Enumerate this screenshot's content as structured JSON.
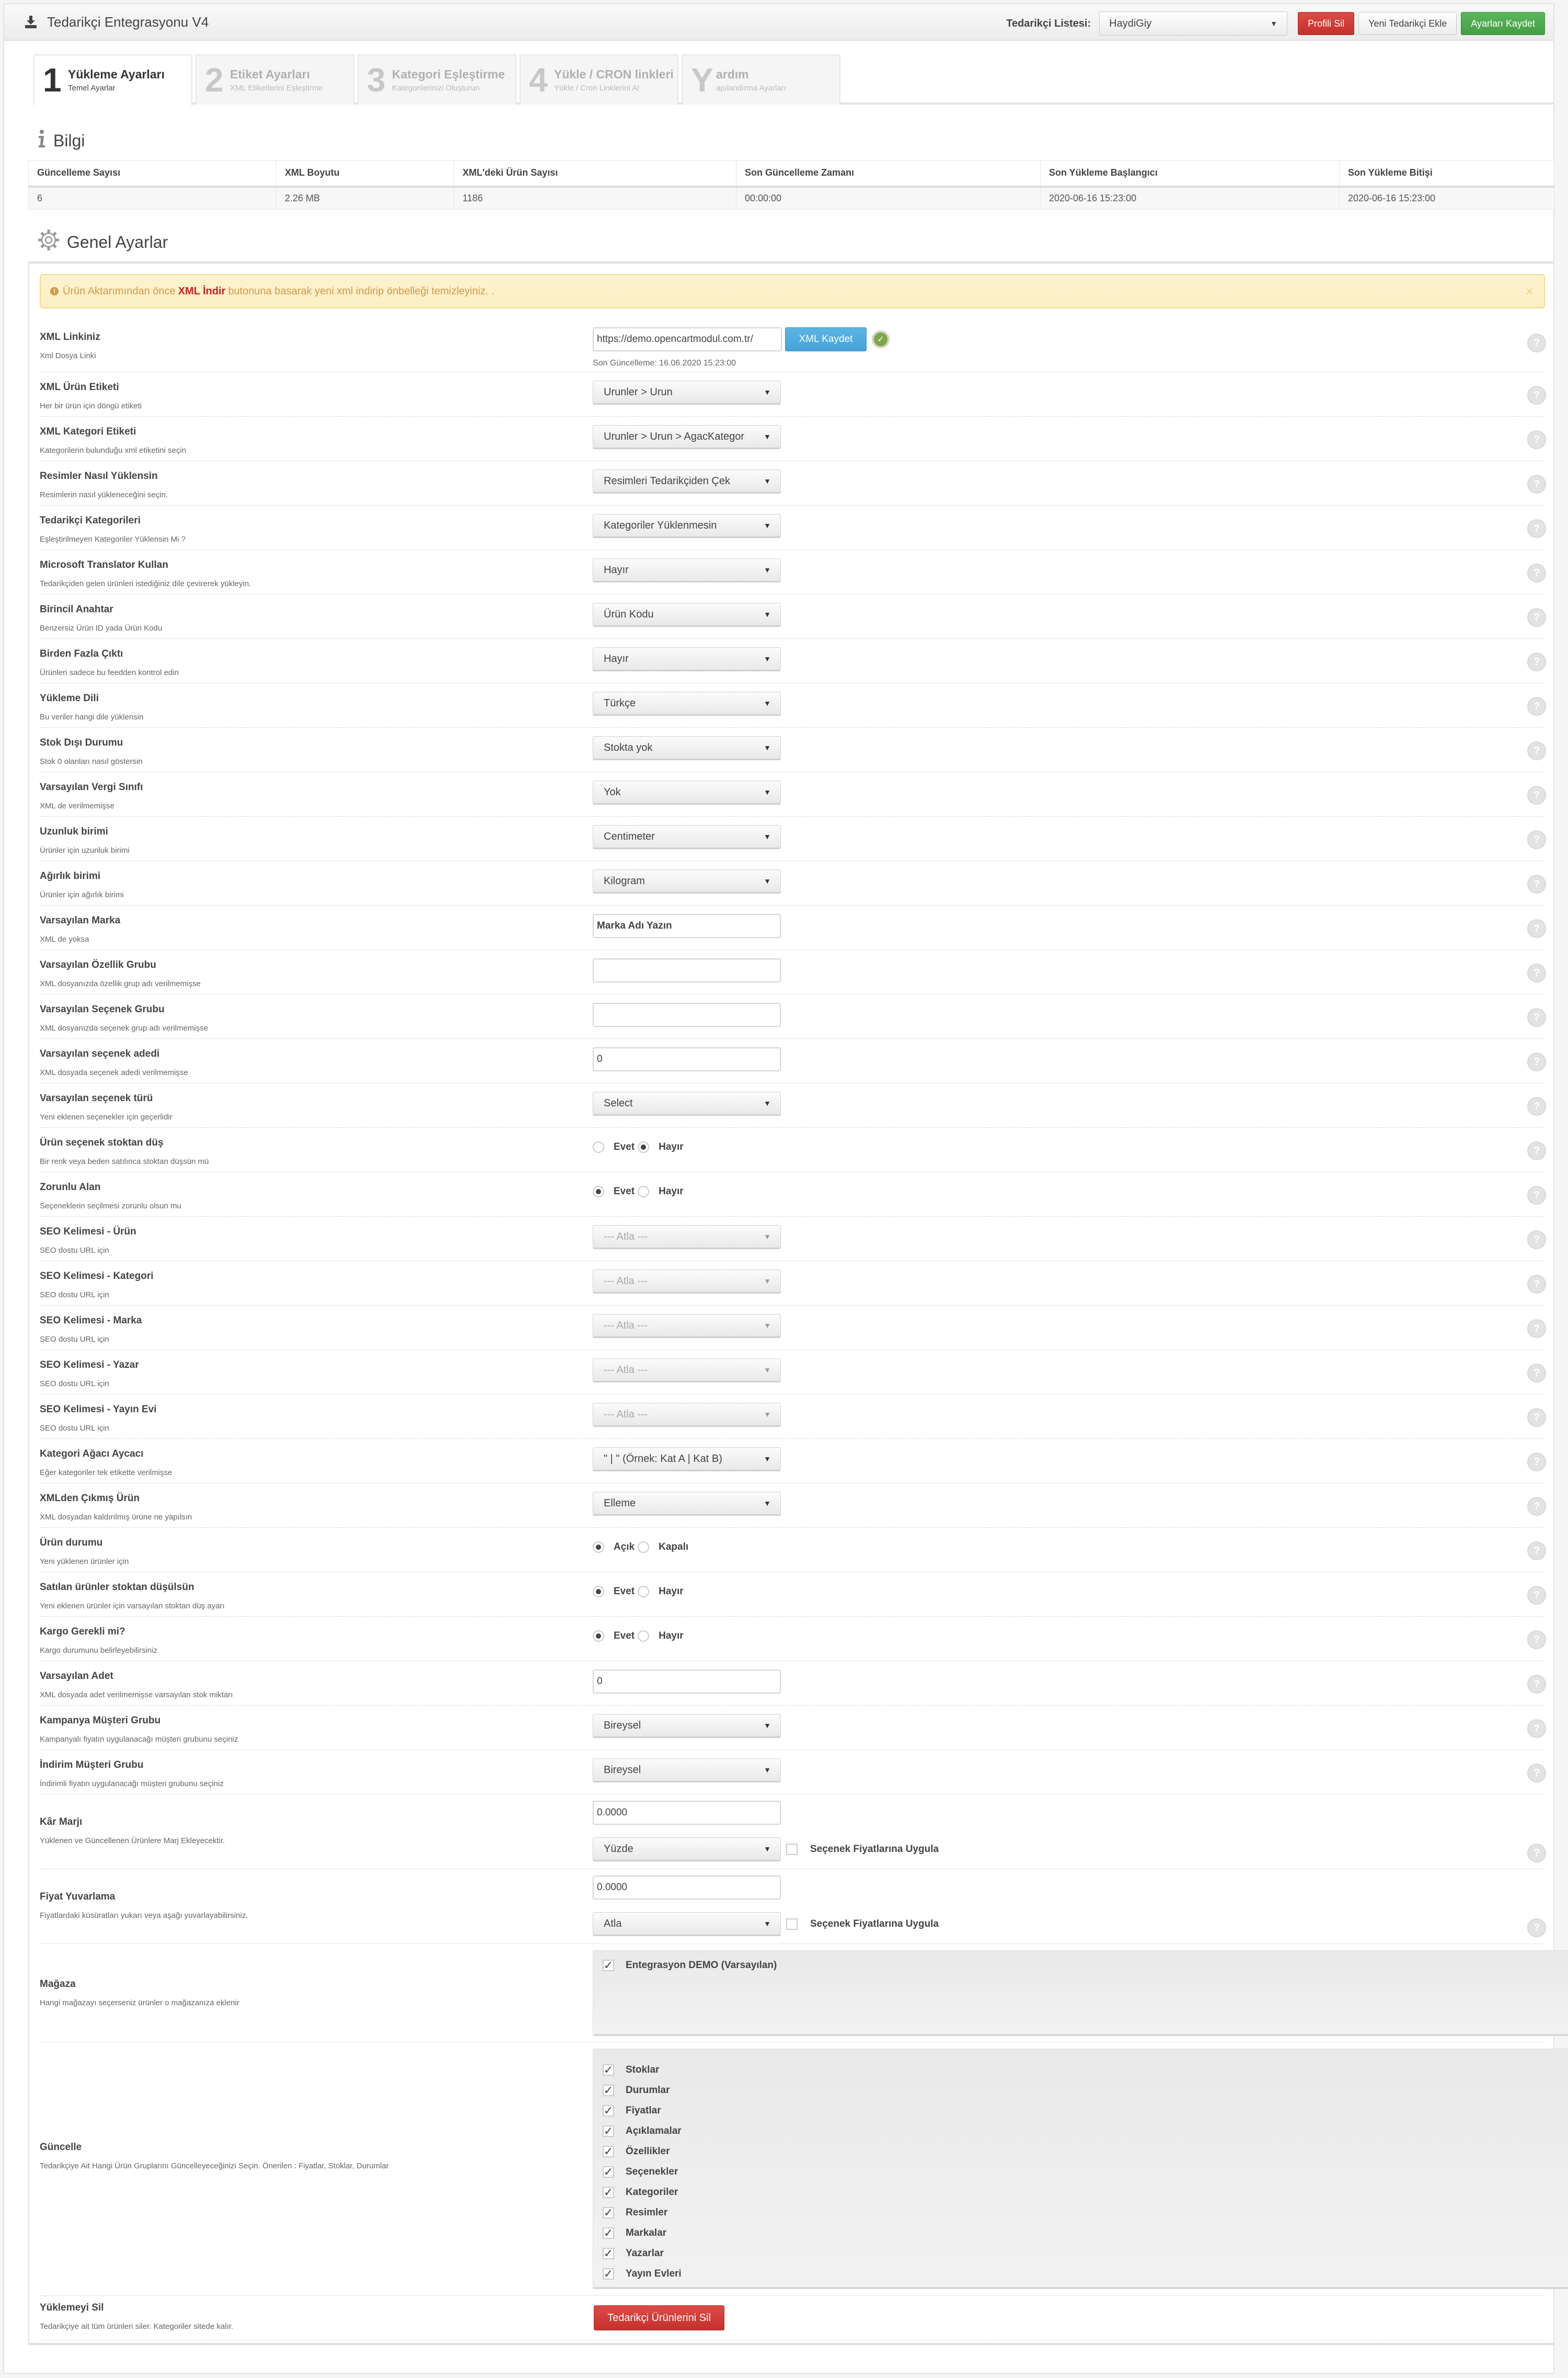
{
  "header": {
    "title": "Tedarikçi Entegrasyonu V4",
    "title_icon": "download-icon",
    "supplier_label": "Tedarikçi Listesi:",
    "supplier_selected": "HaydiGiy",
    "delete_profile": "Profili Sil",
    "add_supplier": "Yeni Tedarikçi Ekle",
    "save_settings": "Ayarları Kaydet"
  },
  "tabs": [
    {
      "num": "1",
      "title": "Yükleme Ayarları",
      "subtitle": "Temel Ayarlar",
      "active": true
    },
    {
      "num": "2",
      "title": "Etiket Ayarları",
      "subtitle": "XML Etiketlerini Eşleştirme",
      "active": false
    },
    {
      "num": "3",
      "title": "Kategori Eşleştirme",
      "subtitle": "Kategorilerinizi Oluşturun",
      "active": false
    },
    {
      "num": "4",
      "title": "Yükle / CRON linkleri",
      "subtitle": "Yükle / Cron Linklerini Al",
      "active": false
    },
    {
      "num": "Y",
      "title": "ardım",
      "subtitle": "apılandırma Ayarları",
      "active": false
    }
  ],
  "info": {
    "title": "Bilgi",
    "icon": "info-icon",
    "columns": [
      "Güncelleme Sayısı",
      "XML Boyutu",
      "XML'deki Ürün Sayısı",
      "Son Güncelleme Zamanı",
      "Son Yükleme Başlangıcı",
      "Son Yükleme Bitişi"
    ],
    "row": [
      "6",
      "2.26 MB",
      "1186",
      "00:00:00",
      "2020-06-16 15:23:00",
      "2020-06-16 15:23:00"
    ]
  },
  "general": {
    "title": "Genel Ayarlar",
    "icon": "gear-icon",
    "alert": {
      "before": "Ürün Aktarımından önce",
      "highlight": "XML İndir",
      "after": "butonuna basarak yeni xml indirip önbelleği temizleyiniz. .",
      "close": "×"
    },
    "xml_link": {
      "label": "XML Linkiniz",
      "hint": "Xml Dosya Linki",
      "value": "https://demo.opencartmodul.com.tr/",
      "button": "XML Kaydet",
      "last_update": "Son Güncelleme: 16.06.2020 15:23:00"
    },
    "rows": [
      {
        "label": "XML Ürün Etiketi",
        "hint": "Her bir ürün için döngü etiketi",
        "type": "select",
        "value": "Urunler > Urun"
      },
      {
        "label": "XML Kategori Etiketi",
        "hint": "Kategorilerin bulunduğu xml etiketini seçin",
        "type": "select",
        "value": "Urunler > Urun > AgacKategor"
      },
      {
        "label": "Resimler Nasıl Yüklensin",
        "hint": "Resimlerin nasıl yükleneceğini seçin.",
        "type": "select",
        "value": "Resimleri Tedarikçiden Çek"
      },
      {
        "label": "Tedarikçi Kategorileri",
        "hint": "Eşleştirilmeyen Kategoriler Yüklensin Mi ?",
        "type": "select",
        "value": "Kategoriler Yüklenmesin"
      },
      {
        "label": "Microsoft Translator Kullan",
        "hint": "Tedarikçiden gelen ürünleri istediğiniz dile çevirerek yükleyin.",
        "type": "select",
        "value": "Hayır"
      },
      {
        "label": "Birincil Anahtar",
        "hint": "Benzersiz Ürün ID yada Ürün Kodu",
        "type": "select",
        "value": "Ürün Kodu"
      },
      {
        "label": "Birden Fazla Çıktı",
        "hint": "Ürünleri sadece bu feedden kontrol edin",
        "type": "select",
        "value": "Hayır"
      },
      {
        "label": "Yükleme Dili",
        "hint": "Bu veriler hangi dile yüklensin",
        "type": "select",
        "value": "Türkçe"
      },
      {
        "label": "Stok Dışı Durumu",
        "hint": "Stok 0 olanları nasıl göstersin",
        "type": "select",
        "value": "Stokta yok"
      },
      {
        "label": "Varsayılan Vergi Sınıfı",
        "hint": "XML de verilmemişse",
        "type": "select",
        "value": "Yok"
      },
      {
        "label": "Uzunluk birimi",
        "hint": "Ürünler için uzunluk birimi",
        "type": "select",
        "value": "Centimeter"
      },
      {
        "label": "Ağırlık birimi",
        "hint": "Ürünler için ağırlık birimi",
        "type": "select",
        "value": "Kilogram"
      },
      {
        "label": "Varsayılan Marka",
        "hint": "XML de yoksa",
        "type": "input",
        "value": "Marka Adı Yazın",
        "bold": true
      },
      {
        "label": "Varsayılan Özellik Grubu",
        "hint": "XML dosyanızda özellik grup adı verilmemişse",
        "type": "input",
        "value": ""
      },
      {
        "label": "Varsayılan Seçenek Grubu",
        "hint": "XML dosyanızda seçenek grup adı verilmemişse",
        "type": "input",
        "value": ""
      },
      {
        "label": "Varsayılan seçenek adedi",
        "hint": "XML dosyada seçenek adedi verilmemişse",
        "type": "input",
        "value": "0"
      },
      {
        "label": "Varsayılan seçenek türü",
        "hint": "Yeni eklenen seçenekler için geçerlidir",
        "type": "select",
        "value": "Select"
      },
      {
        "label": "Ürün seçenek stoktan düş",
        "hint": "Bir renk veya beden satılınca stoktan düşsün mü",
        "type": "radio",
        "options": [
          "Evet",
          "Hayır"
        ],
        "selected": 1
      },
      {
        "label": "Zorunlu Alan",
        "hint": "Seçeneklerin seçilmesi zorunlu olsun mu",
        "type": "radio",
        "options": [
          "Evet",
          "Hayır"
        ],
        "selected": 0
      },
      {
        "label": "SEO Kelimesi - Ürün",
        "hint": "SEO dostu URL için",
        "type": "select",
        "value": "--- Atla ---",
        "disabled": true
      },
      {
        "label": "SEO Kelimesi - Kategori",
        "hint": "SEO dostu URL için",
        "type": "select",
        "value": "--- Atla ---",
        "disabled": true
      },
      {
        "label": "SEO Kelimesi - Marka",
        "hint": "SEO dostu URL için",
        "type": "select",
        "value": "--- Atla ---",
        "disabled": true
      },
      {
        "label": "SEO Kelimesi - Yazar",
        "hint": "SEO dostu URL için",
        "type": "select",
        "value": "--- Atla ---",
        "disabled": true
      },
      {
        "label": "SEO Kelimesi - Yayın Evi",
        "hint": "SEO dostu URL için",
        "type": "select",
        "value": "--- Atla ---",
        "disabled": true
      },
      {
        "label": "Kategori Ağacı Aycacı",
        "hint": "Eğer kategoriler tek etikette verilmişse",
        "type": "select",
        "value": "\" | \" (Örnek: Kat A | Kat B)"
      },
      {
        "label": "XMLden Çıkmış Ürün",
        "hint": "XML dosyadan kaldırılmış ürüne ne yapılsın",
        "type": "select",
        "value": "Elleme"
      },
      {
        "label": "Ürün durumu",
        "hint": "Yeni yüklenen ürünler için",
        "type": "radio",
        "options": [
          "Açık",
          "Kapalı"
        ],
        "selected": 0
      },
      {
        "label": "Satılan ürünler stoktan düşülsün",
        "hint": "Yeni eklenen ürünler için varsayılan stoktan düş ayarı",
        "type": "radio",
        "options": [
          "Evet",
          "Hayır"
        ],
        "selected": 0
      },
      {
        "label": "Kargo Gerekli mi?",
        "hint": "Kargo durumunu belirleyebilirsiniz",
        "type": "radio",
        "options": [
          "Evet",
          "Hayır"
        ],
        "selected": 0
      },
      {
        "label": "Varsayılan Adet",
        "hint": "XML dosyada adet verilmemişse varsayılan stok miktarı",
        "type": "input",
        "value": "0"
      },
      {
        "label": "Kampanya Müşteri Grubu",
        "hint": "Kampanyalı fiyatın uygulanacağı müşteri grubunu seçiniz",
        "type": "select",
        "value": "Bireysel"
      },
      {
        "label": "İndirim Müşteri Grubu",
        "hint": "İndirimli fiyatın uygulanacağı müşteri grubunu seçiniz",
        "type": "select",
        "value": "Bireysel"
      }
    ],
    "profit_margin": {
      "label": "Kâr Marjı",
      "hint": "Yüklenen ve Güncellenen Ürünlere Marj Ekleyecektir.",
      "value": "0.0000",
      "mode": "Yüzde",
      "apply_options_label": "Seçenek Fiyatlarına Uygula",
      "apply_options_checked": false
    },
    "price_rounding": {
      "label": "Fiyat Yuvarlama",
      "hint": "Fiyatlardaki küsüratları yukarı veya aşağı yuvarlayabilirsiniz.",
      "value": "0.0000",
      "mode": "Atla",
      "apply_options_label": "Seçenek Fiyatlarına Uygula",
      "apply_options_checked": false
    },
    "store": {
      "label": "Mağaza",
      "hint": "Hangi mağazayı seçerseniz ürünler o mağazanıza eklenir",
      "items": [
        {
          "label": "Entegrasyon DEMO (Varsayılan)",
          "checked": true
        }
      ]
    },
    "update": {
      "label": "Güncelle",
      "hint": "Tedarikçiye Ait Hangi Ürün Gruplarını Güncelleyeceğinizi Seçin. Önerilen : Fiyatlar, Stoklar, Durumlar",
      "items": [
        {
          "label": "Stoklar",
          "checked": true
        },
        {
          "label": "Durumlar",
          "checked": true
        },
        {
          "label": "Fiyatlar",
          "checked": true
        },
        {
          "label": "Açıklamalar",
          "checked": true
        },
        {
          "label": "Özellikler",
          "checked": true
        },
        {
          "label": "Seçenekler",
          "checked": true
        },
        {
          "label": "Kategoriler",
          "checked": true
        },
        {
          "label": "Resimler",
          "checked": true
        },
        {
          "label": "Markalar",
          "checked": true
        },
        {
          "label": "Yazarlar",
          "checked": true
        },
        {
          "label": "Yayın Evleri",
          "checked": true
        }
      ]
    },
    "delete_import": {
      "label": "Yüklemeyi Sil",
      "hint": "Tedarikçiye ait tüm ürünleri siler. Kategoriler sitede kalır.",
      "button": "Tedarikçi Ürünlerini Sil"
    },
    "help_icon": "?"
  }
}
